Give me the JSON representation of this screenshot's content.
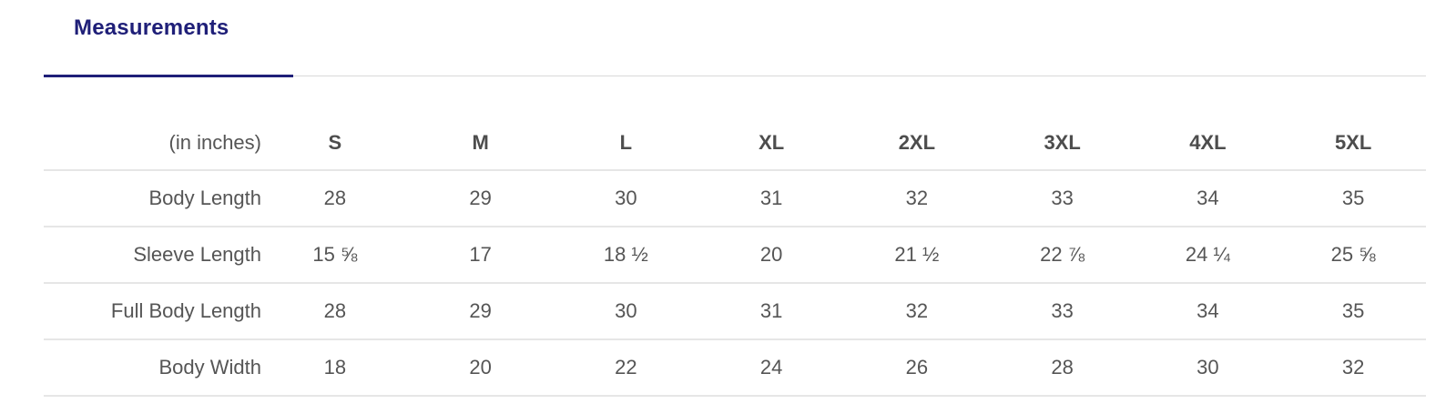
{
  "tabs": [
    {
      "label": "Measurements",
      "active": true
    }
  ],
  "colors": {
    "accent": "#1f1f78",
    "text": "#555555",
    "divider": "#e6e6e6"
  },
  "table": {
    "unit_label": "(in inches)",
    "sizes": [
      "S",
      "M",
      "L",
      "XL",
      "2XL",
      "3XL",
      "4XL",
      "5XL"
    ],
    "rows": [
      {
        "label": "Body Length",
        "values": [
          "28",
          "29",
          "30",
          "31",
          "32",
          "33",
          "34",
          "35"
        ]
      },
      {
        "label": "Sleeve Length",
        "values": [
          "15 ⅝",
          "17",
          "18 ½",
          "20",
          "21 ½",
          "22 ⅞",
          "24 ¼",
          "25 ⅝"
        ]
      },
      {
        "label": "Full Body Length",
        "values": [
          "28",
          "29",
          "30",
          "31",
          "32",
          "33",
          "34",
          "35"
        ]
      },
      {
        "label": "Body Width",
        "values": [
          "18",
          "20",
          "22",
          "24",
          "26",
          "28",
          "30",
          "32"
        ]
      }
    ]
  }
}
